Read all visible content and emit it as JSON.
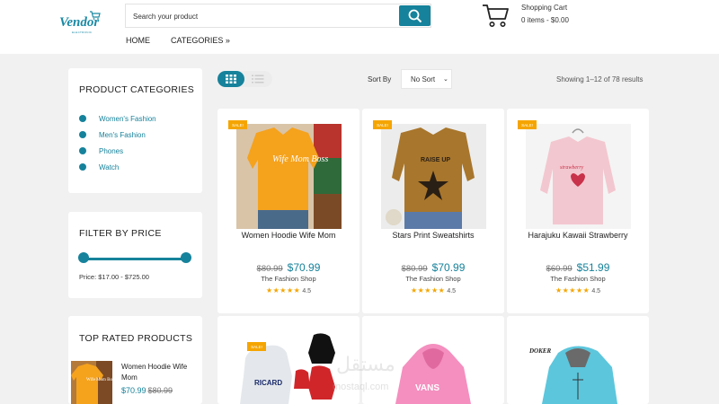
{
  "brand": {
    "logo_text": "Vendor",
    "logo_sub": "ELECTRONIC"
  },
  "search": {
    "placeholder": "Search your product"
  },
  "cart": {
    "title": "Shopping Cart",
    "summary": "0 items - $0.00"
  },
  "nav": {
    "home": "HOME",
    "categories": "CATEGORIES »"
  },
  "sidebar": {
    "categories_title": "PRODUCT CATEGORIES",
    "categories": [
      {
        "label": "Women's Fashion"
      },
      {
        "label": "Men's Fashion"
      },
      {
        "label": "Phones"
      },
      {
        "label": "Watch"
      }
    ],
    "filter_title": "FILTER BY PRICE",
    "price_range": "Price: $17.00 - $725.00",
    "price_min": 17,
    "price_max": 725,
    "top_rated_title": "TOP RATED PRODUCTS",
    "top_rated": [
      {
        "name": "Women Hoodie Wife Mom",
        "price": "$70.99",
        "old_price": "$80.99"
      }
    ]
  },
  "toolbar": {
    "sort_label": "Sort By",
    "sort_value": "No Sort",
    "showing": "Showing 1–12 of 78 results"
  },
  "products": [
    {
      "name": "Women Hoodie Wife Mom",
      "old_price": "$80.99",
      "price": "$70.99",
      "shop": "The Fashion Shop",
      "rating": "4.5",
      "badge": "SALE!",
      "stars": "★★★★★"
    },
    {
      "name": "Stars Print Sweatshirts",
      "old_price": "$80.99",
      "price": "$70.99",
      "shop": "The Fashion Shop",
      "rating": "4.5",
      "badge": "SALE!",
      "stars": "★★★★★"
    },
    {
      "name": "Harajuku Kawaii Strawberry",
      "old_price": "$60.99",
      "price": "$51.99",
      "shop": "The Fashion Shop",
      "rating": "4.5",
      "badge": "SALE!",
      "stars": "★★★★★"
    },
    {
      "name": "",
      "badge": "SALE!",
      "print": "RICARD"
    },
    {
      "name": "",
      "print": "VANS"
    },
    {
      "name": "",
      "print": "DOKER"
    }
  ],
  "print_texts": {
    "wife_mom": "Wife Mom Boss",
    "raise_up": "RAISE UP",
    "strawberry": "strawberry"
  },
  "watermark": {
    "logo": "مستقل",
    "text": "mostaql.com"
  },
  "colors": {
    "accent": "#16829b",
    "sale": "#f5a500",
    "background": "#f1f1f1"
  }
}
